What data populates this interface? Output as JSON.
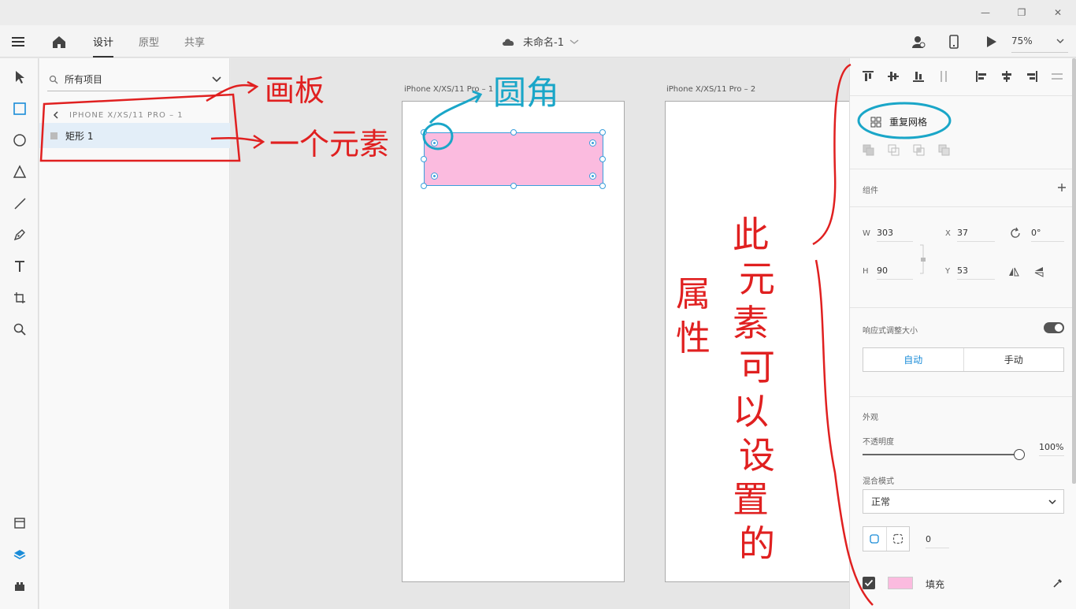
{
  "window": {
    "min": "—",
    "restore": "❐",
    "close": "✕"
  },
  "header": {
    "tabs": [
      {
        "label": "设计"
      },
      {
        "label": "原型"
      },
      {
        "label": "共享"
      }
    ],
    "doc_title": "未命名-1",
    "zoom": "75%"
  },
  "layers": {
    "search_label": "所有项目",
    "breadcrumb": "IPHONE X/XS/11 PRO – 1",
    "items": [
      {
        "label": "矩形 1"
      }
    ]
  },
  "canvas": {
    "artboards": [
      {
        "label": "iPhone X/XS/11 Pro – 1"
      },
      {
        "label": "iPhone X/XS/11 Pro – 2"
      }
    ]
  },
  "props": {
    "repeat_grid": "重复网格",
    "components_label": "组件",
    "w_label": "W",
    "w_value": "303",
    "h_label": "H",
    "h_value": "90",
    "x_label": "X",
    "x_value": "37",
    "y_label": "Y",
    "y_value": "53",
    "rotation_value": "0°",
    "responsive_label": "响应式调整大小",
    "auto_label": "自动",
    "manual_label": "手动",
    "appearance_label": "外观",
    "opacity_label": "不透明度",
    "opacity_value": "100%",
    "blend_label": "混合模式",
    "blend_value": "正常",
    "corner_value": "0",
    "fill_label": "填充",
    "fill_color": "#fbbbdf",
    "accent": "#1a8cd8"
  },
  "annotations": {
    "artboard": "画板",
    "one_element": "一个元素",
    "rounded_corner": "圆角",
    "property": "属性",
    "settable_lines": [
      "此",
      "元",
      "素",
      "可",
      "以",
      "设",
      "置",
      "的"
    ]
  }
}
